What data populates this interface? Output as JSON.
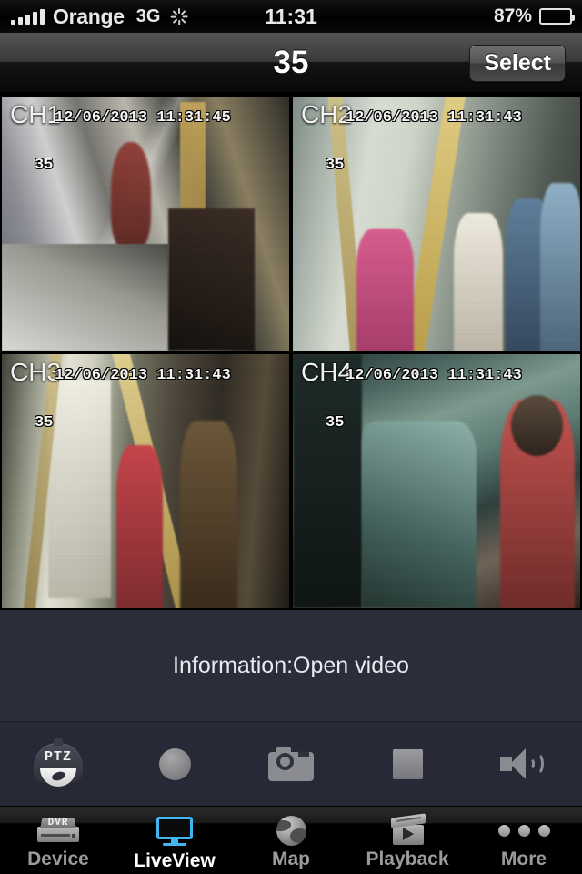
{
  "status_bar": {
    "signal_bars": 5,
    "carrier": "Orange",
    "network": "3G",
    "spinner": "activity-spinner",
    "time": "11:31",
    "battery_percent": "87%",
    "battery_level": 87
  },
  "nav_bar": {
    "title": "35",
    "select_label": "Select"
  },
  "video_grid": {
    "selected_channel": "CH1",
    "selection_color": "#00ff00",
    "cells": [
      {
        "channel": "CH1",
        "timestamp": "12/06/2013 11:31:45",
        "osd_number": "35",
        "selected": true,
        "scene": "bus-interior-front-driver-area"
      },
      {
        "channel": "CH2",
        "timestamp": "12/06/2013 11:31:43",
        "osd_number": "35",
        "selected": false,
        "scene": "bus-interior-crowded-aisle"
      },
      {
        "channel": "CH3",
        "timestamp": "12/06/2013 11:31:43",
        "osd_number": "35",
        "selected": false,
        "scene": "bus-interior-rear-door"
      },
      {
        "channel": "CH4",
        "timestamp": "12/06/2013 11:31:43",
        "osd_number": "35",
        "selected": false,
        "scene": "bus-interior-seats-dark"
      }
    ]
  },
  "info_panel": {
    "text": "Information:Open video",
    "background_color": "#2b2d3b"
  },
  "control_bar": {
    "background_color": "#272936",
    "buttons": [
      {
        "name": "ptz",
        "icon": "ptz-dome-camera-icon",
        "label": "PTZ"
      },
      {
        "name": "record",
        "icon": "record-circle-icon",
        "label": ""
      },
      {
        "name": "snapshot",
        "icon": "camera-icon",
        "label": ""
      },
      {
        "name": "stop",
        "icon": "stop-square-icon",
        "label": ""
      },
      {
        "name": "audio",
        "icon": "speaker-icon",
        "label": ""
      }
    ]
  },
  "tab_bar": {
    "active": "LiveView",
    "active_color": "#3fb6ef",
    "tabs": [
      {
        "label": "Device",
        "icon": "dvr-icon",
        "active": false
      },
      {
        "label": "LiveView",
        "icon": "monitor-icon",
        "active": true
      },
      {
        "label": "Map",
        "icon": "globe-icon",
        "active": false
      },
      {
        "label": "Playback",
        "icon": "clapper-icon",
        "active": false
      },
      {
        "label": "More",
        "icon": "ellipsis-icon",
        "active": false
      }
    ]
  }
}
